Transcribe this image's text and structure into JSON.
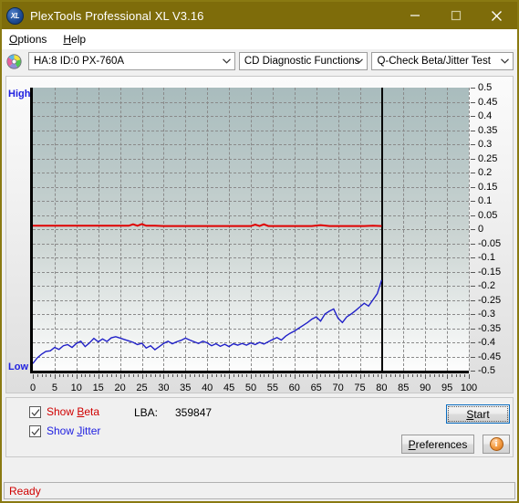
{
  "window": {
    "title": "PlexTools Professional XL V3.16",
    "icon": "xl-disc-icon",
    "minimize_label": "Minimize",
    "maximize_label": "Maximize",
    "close_label": "Close"
  },
  "menubar": {
    "items": [
      {
        "label": "Options",
        "accel": "O"
      },
      {
        "label": "Help",
        "accel": "H"
      }
    ]
  },
  "toolbar": {
    "disc_icon": "cd-disc-icon",
    "drive_select": {
      "value": "HA:8 ID:0  PX-760A",
      "options": [
        "HA:8 ID:0  PX-760A"
      ]
    },
    "function_select": {
      "value": "CD Diagnostic Functions",
      "options": [
        "CD Diagnostic Functions"
      ]
    },
    "test_select": {
      "value": "Q-Check Beta/Jitter Test",
      "options": [
        "Q-Check Beta/Jitter Test"
      ]
    }
  },
  "controls": {
    "show_beta_label": "Show Beta",
    "show_beta_checked": true,
    "show_jitter_label": "Show Jitter",
    "show_jitter_checked": true,
    "lba_label": "LBA:",
    "lba_value": "359847",
    "start_label": "Start",
    "preferences_label": "Preferences",
    "info_label": "i"
  },
  "statusbar": {
    "text": "Ready"
  },
  "colors": {
    "titlebar": "#7e6c0a",
    "beta": "#e00000",
    "jitter": "#2020c8",
    "axis_label": "#2020e0",
    "status_text": "#d00000",
    "plot_top": "#a9bcbd",
    "plot_bottom": "#fdfdfd"
  },
  "chart_data": {
    "type": "line",
    "title": "",
    "xlabel": "",
    "ylabel": "",
    "xlim": [
      0,
      100
    ],
    "ylim": [
      -0.5,
      0.5
    ],
    "grid": true,
    "left_axis_labels": {
      "high": "High",
      "low": "Low"
    },
    "xticks": [
      0,
      5,
      10,
      15,
      20,
      25,
      30,
      35,
      40,
      45,
      50,
      55,
      60,
      65,
      70,
      75,
      80,
      85,
      90,
      95,
      100
    ],
    "yticks": [
      0.5,
      0.45,
      0.4,
      0.35,
      0.3,
      0.25,
      0.2,
      0.15,
      0.1,
      0.05,
      0,
      -0.05,
      -0.1,
      -0.15,
      -0.2,
      -0.25,
      -0.3,
      -0.35,
      -0.4,
      -0.45,
      -0.5
    ],
    "ytick_labels": [
      "0.5",
      "0.45",
      "0.4",
      "0.35",
      "0.3",
      "0.25",
      "0.2",
      "0.15",
      "0.1",
      "0.05",
      "0",
      "-0.05",
      "-0.1",
      "-0.15",
      "-0.2",
      "-0.25",
      "-0.3",
      "-0.35",
      "-0.4",
      "-0.45",
      "-0.5"
    ],
    "marker_x": 80,
    "data_end_x": 80,
    "series": [
      {
        "name": "Beta",
        "color": "#e00000",
        "x": [
          0,
          2,
          4,
          6,
          8,
          10,
          12,
          14,
          16,
          18,
          20,
          22,
          23,
          24,
          25,
          26,
          28,
          30,
          32,
          34,
          36,
          38,
          40,
          42,
          44,
          46,
          48,
          50,
          51,
          52,
          53,
          54,
          56,
          58,
          60,
          62,
          64,
          66,
          68,
          70,
          72,
          74,
          76,
          78,
          80
        ],
        "y": [
          0.012,
          0.012,
          0.012,
          0.012,
          0.012,
          0.012,
          0.012,
          0.012,
          0.012,
          0.012,
          0.012,
          0.012,
          0.017,
          0.012,
          0.018,
          0.012,
          0.012,
          0.011,
          0.011,
          0.011,
          0.011,
          0.011,
          0.011,
          0.011,
          0.011,
          0.011,
          0.011,
          0.011,
          0.016,
          0.011,
          0.017,
          0.011,
          0.011,
          0.011,
          0.011,
          0.011,
          0.011,
          0.014,
          0.011,
          0.011,
          0.011,
          0.011,
          0.011,
          0.012,
          0.011
        ]
      },
      {
        "name": "Jitter",
        "color": "#2020c8",
        "x": [
          0,
          1,
          2,
          3,
          4,
          5,
          6,
          7,
          8,
          9,
          10,
          11,
          12,
          13,
          14,
          15,
          16,
          17,
          18,
          19,
          20,
          21,
          22,
          23,
          24,
          25,
          26,
          27,
          28,
          29,
          30,
          31,
          32,
          33,
          34,
          35,
          36,
          37,
          38,
          39,
          40,
          41,
          42,
          43,
          44,
          45,
          46,
          47,
          48,
          49,
          50,
          51,
          52,
          53,
          54,
          55,
          56,
          57,
          58,
          59,
          60,
          61,
          62,
          63,
          64,
          65,
          66,
          67,
          68,
          69,
          70,
          71,
          72,
          73,
          74,
          75,
          76,
          77,
          78,
          79,
          80
        ],
        "y": [
          -0.475,
          -0.455,
          -0.442,
          -0.432,
          -0.43,
          -0.418,
          -0.425,
          -0.412,
          -0.408,
          -0.418,
          -0.404,
          -0.396,
          -0.415,
          -0.402,
          -0.386,
          -0.398,
          -0.388,
          -0.397,
          -0.384,
          -0.38,
          -0.385,
          -0.39,
          -0.395,
          -0.4,
          -0.408,
          -0.403,
          -0.42,
          -0.412,
          -0.426,
          -0.415,
          -0.404,
          -0.396,
          -0.405,
          -0.398,
          -0.393,
          -0.385,
          -0.392,
          -0.398,
          -0.404,
          -0.396,
          -0.402,
          -0.412,
          -0.405,
          -0.414,
          -0.407,
          -0.415,
          -0.405,
          -0.41,
          -0.404,
          -0.41,
          -0.402,
          -0.408,
          -0.4,
          -0.406,
          -0.398,
          -0.39,
          -0.383,
          -0.392,
          -0.378,
          -0.368,
          -0.36,
          -0.35,
          -0.34,
          -0.33,
          -0.318,
          -0.31,
          -0.325,
          -0.3,
          -0.29,
          -0.282,
          -0.315,
          -0.33,
          -0.31,
          -0.3,
          -0.288,
          -0.275,
          -0.262,
          -0.272,
          -0.25,
          -0.228,
          -0.18
        ]
      }
    ]
  }
}
